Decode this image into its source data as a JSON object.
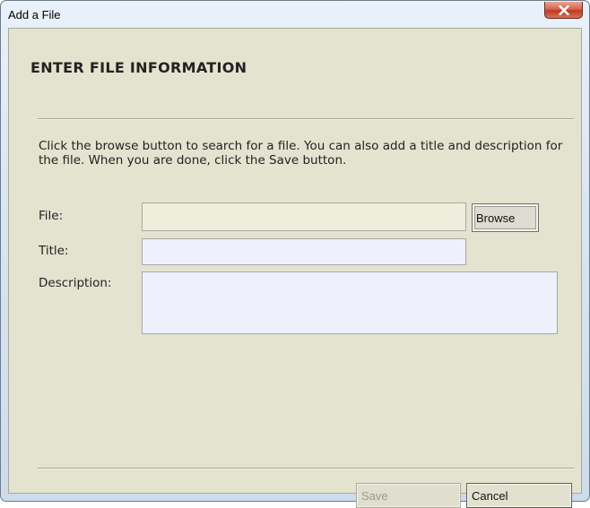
{
  "window": {
    "title": "Add a File",
    "close_icon": "close-x-icon"
  },
  "form": {
    "heading": "ENTER FILE INFORMATION",
    "instructions": "Click the browse button to search for a file.  You can also add a title and description for the file.  When you are done, click the Save button.",
    "file_label": "File:",
    "file_value": "",
    "browse_label": "Browse",
    "title_label": "Title:",
    "title_value": "",
    "description_label": "Description:",
    "description_value": ""
  },
  "footer": {
    "save_label": "Save",
    "save_disabled": true,
    "cancel_label": "Cancel"
  },
  "colors": {
    "panel_background": "#e4e3cf",
    "file_field_background": "#efeedc",
    "text_field_background": "#eef1fb",
    "close_button_red": "#c2391f"
  }
}
